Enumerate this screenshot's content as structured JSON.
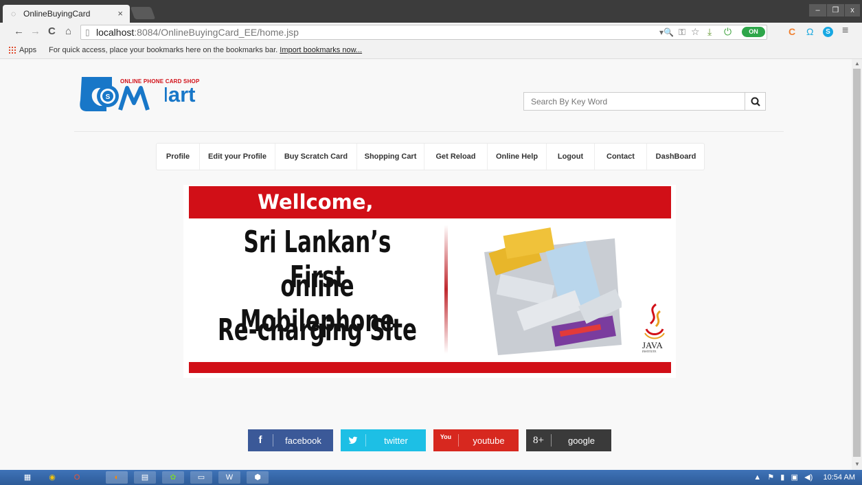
{
  "browser": {
    "tab_title": "OnlineBuyingCard",
    "tab_close": "×",
    "url_host": "localhost",
    "url_rest": ":8084/OnlineBuyingCard_EE/home.jsp",
    "window_controls": [
      "–",
      "❐",
      "x"
    ],
    "toggle_label": "ON"
  },
  "bookmarks": {
    "apps_label": "Apps",
    "hint": "For quick access, place your bookmarks here on the bookmarks bar.",
    "import_link": "Import bookmarks now..."
  },
  "header": {
    "logo_tagline": "ONLINE PHONE CARD SHOP",
    "logo_word": "Mart",
    "search_placeholder": "Search By Key Word"
  },
  "nav": {
    "items": [
      "Profile",
      "Edit your Profile",
      "Buy Scratch Card",
      "Shopping Cart",
      "Get Reload",
      "Online Help",
      "Logout",
      "Contact",
      "DashBoard"
    ]
  },
  "banner": {
    "welcome": "Wellcome,",
    "line1": "Sri Lankan’s First",
    "line2": "online Mobilephone",
    "line3": "Re-charging Site",
    "java_logo": "JAVA",
    "java_sub": "INSTITUTE"
  },
  "social": [
    {
      "icon": "f",
      "label": "facebook",
      "color": "#3b5998"
    },
    {
      "icon": "t",
      "label": "twitter",
      "color": "#1dbfe5"
    },
    {
      "icon": "You",
      "label": "youtube",
      "color": "#d7281f"
    },
    {
      "icon": "8+",
      "label": "google",
      "color": "#3a3a3a"
    }
  ],
  "taskbar": {
    "clock": "10:54 AM"
  }
}
